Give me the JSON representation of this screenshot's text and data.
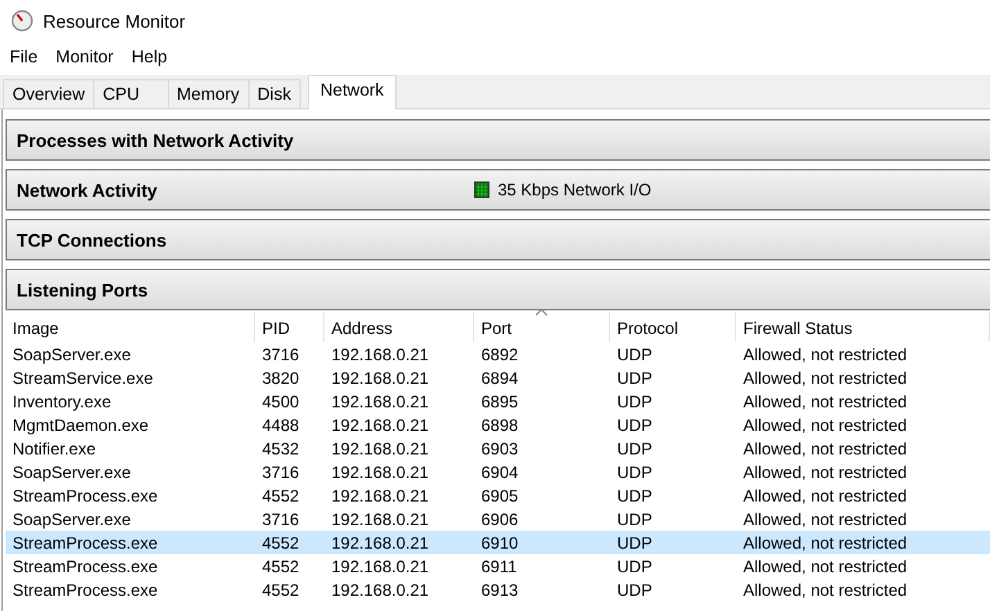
{
  "window": {
    "title": "Resource Monitor"
  },
  "menu": [
    "File",
    "Monitor",
    "Help"
  ],
  "tabs": [
    {
      "label": "Overview",
      "selected": false
    },
    {
      "label": "CPU",
      "selected": false
    },
    {
      "label": "Memory",
      "selected": false
    },
    {
      "label": "Disk",
      "selected": false
    },
    {
      "label": "Network",
      "selected": true
    }
  ],
  "sections": [
    {
      "title": "Processes with Network Activity"
    },
    {
      "title": "Network Activity",
      "summary": "35 Kbps Network I/O"
    },
    {
      "title": "TCP Connections"
    },
    {
      "title": "Listening Ports",
      "table": {
        "columns": [
          {
            "label": "Image",
            "sorted": false
          },
          {
            "label": "PID",
            "sorted": false
          },
          {
            "label": "Address",
            "sorted": false
          },
          {
            "label": "Port",
            "sorted": true
          },
          {
            "label": "Protocol",
            "sorted": false
          },
          {
            "label": "Firewall Status",
            "sorted": false
          }
        ],
        "rows": [
          {
            "cells": [
              "SoapServer.exe",
              "3716",
              "192.168.0.21",
              "6892",
              "UDP",
              "Allowed, not restricted"
            ],
            "selected": false
          },
          {
            "cells": [
              "StreamService.exe",
              "3820",
              "192.168.0.21",
              "6894",
              "UDP",
              "Allowed, not restricted"
            ],
            "selected": false
          },
          {
            "cells": [
              "Inventory.exe",
              "4500",
              "192.168.0.21",
              "6895",
              "UDP",
              "Allowed, not restricted"
            ],
            "selected": false
          },
          {
            "cells": [
              "MgmtDaemon.exe",
              "4488",
              "192.168.0.21",
              "6898",
              "UDP",
              "Allowed, not restricted"
            ],
            "selected": false
          },
          {
            "cells": [
              "Notifier.exe",
              "4532",
              "192.168.0.21",
              "6903",
              "UDP",
              "Allowed, not restricted"
            ],
            "selected": false
          },
          {
            "cells": [
              "SoapServer.exe",
              "3716",
              "192.168.0.21",
              "6904",
              "UDP",
              "Allowed, not restricted"
            ],
            "selected": false
          },
          {
            "cells": [
              "StreamProcess.exe",
              "4552",
              "192.168.0.21",
              "6905",
              "UDP",
              "Allowed, not restricted"
            ],
            "selected": false
          },
          {
            "cells": [
              "SoapServer.exe",
              "3716",
              "192.168.0.21",
              "6906",
              "UDP",
              "Allowed, not restricted"
            ],
            "selected": false
          },
          {
            "cells": [
              "StreamProcess.exe",
              "4552",
              "192.168.0.21",
              "6910",
              "UDP",
              "Allowed, not restricted"
            ],
            "selected": true
          },
          {
            "cells": [
              "StreamProcess.exe",
              "4552",
              "192.168.0.21",
              "6911",
              "UDP",
              "Allowed, not restricted"
            ],
            "selected": false
          },
          {
            "cells": [
              "StreamProcess.exe",
              "4552",
              "192.168.0.21",
              "6913",
              "UDP",
              "Allowed, not restricted"
            ],
            "selected": false
          }
        ]
      }
    }
  ]
}
